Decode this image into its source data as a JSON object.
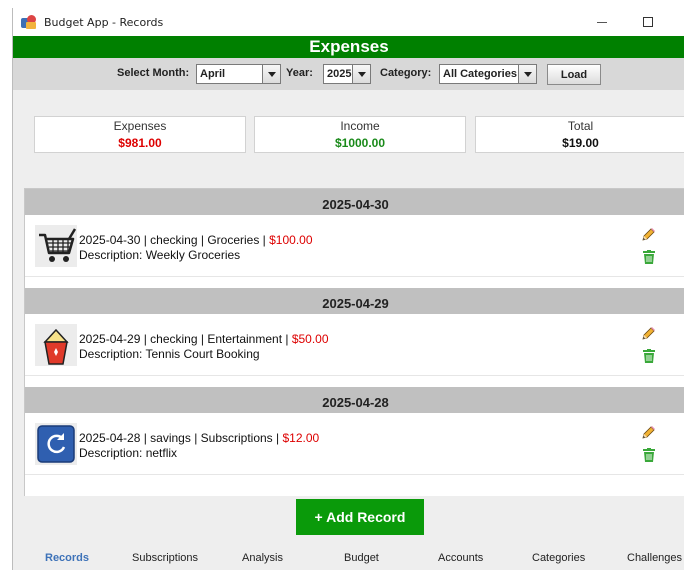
{
  "window": {
    "title": "Budget App - Records"
  },
  "header": {
    "title": "Expenses"
  },
  "filters": {
    "month_label": "Select Month:",
    "month_value": "April",
    "year_label": "Year:",
    "year_value": "2025",
    "category_label": "Category:",
    "category_value": "All Categories",
    "load_label": "Load"
  },
  "summary": {
    "expenses_label": "Expenses",
    "expenses_value": "$981.00",
    "income_label": "Income",
    "income_value": "$1000.00",
    "total_label": "Total",
    "total_value": "$19.00"
  },
  "colors": {
    "header_green": "#008000",
    "expense_red": "#dd0000",
    "income_green": "#1a8a1a",
    "active_tab_blue": "#3d72b8"
  },
  "records": [
    {
      "date": "2025-04-30",
      "info": "2025-04-30 | checking | Groceries | ",
      "amount": "$100.00",
      "description": "Description: Weekly Groceries",
      "icon": "shopping-cart-icon"
    },
    {
      "date": "2025-04-29",
      "info": "2025-04-29 | checking | Entertainment | ",
      "amount": "$50.00",
      "description": "Description: Tennis Court Booking",
      "icon": "popcorn-icon"
    },
    {
      "date": "2025-04-28",
      "info": "2025-04-28 | savings | Subscriptions | ",
      "amount": "$12.00",
      "description": "Description: netflix",
      "icon": "refresh-icon"
    }
  ],
  "actions": {
    "add_record": "+ Add Record"
  },
  "tabs": [
    {
      "label": "Records",
      "active": true
    },
    {
      "label": "Subscriptions"
    },
    {
      "label": "Analysis"
    },
    {
      "label": "Budget"
    },
    {
      "label": "Accounts"
    },
    {
      "label": "Categories"
    },
    {
      "label": "Challenges"
    }
  ]
}
